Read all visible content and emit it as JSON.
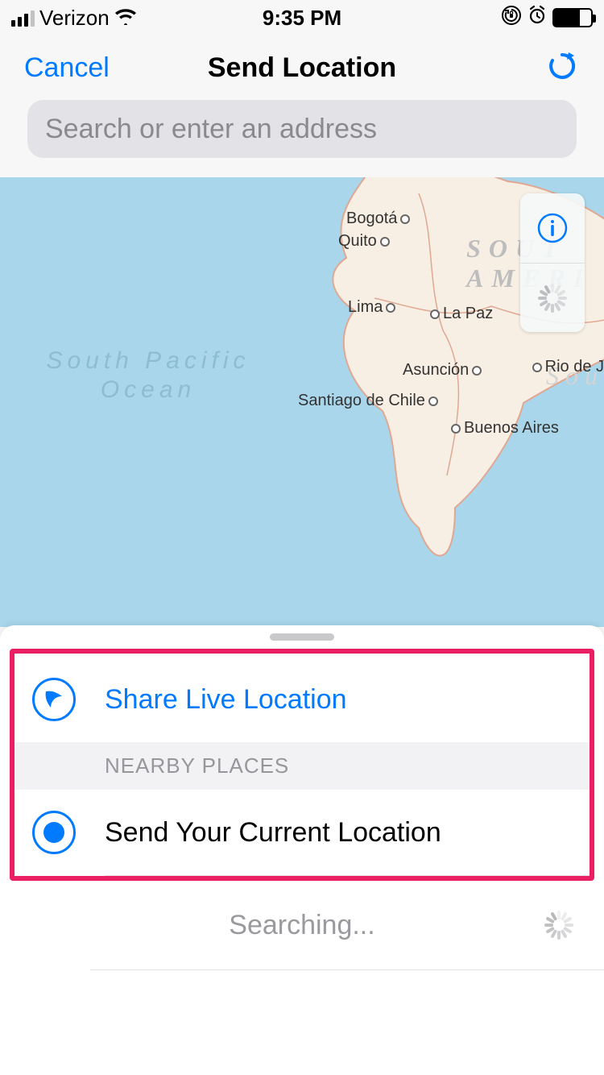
{
  "status": {
    "carrier": "Verizon",
    "time": "9:35 PM"
  },
  "nav": {
    "cancel": "Cancel",
    "title": "Send Location"
  },
  "search": {
    "placeholder": "Search or enter an address",
    "value": ""
  },
  "map": {
    "ocean_label": "South Pacific Ocean",
    "continent_label_1": "SOUT",
    "continent_label_2": "AMERI",
    "continent_label_3": "Sou",
    "rio_label": "Rio de J",
    "cities": {
      "bogota": "Bogotá",
      "quito": "Quito",
      "lima": "Lima",
      "lapaz": "La Paz",
      "asuncion": "Asunción",
      "santiago": "Santiago de Chile",
      "buenos": "Buenos Aires"
    }
  },
  "sheet": {
    "share_live": "Share Live Location",
    "nearby_header": "NEARBY PLACES",
    "send_current": "Send Your Current Location",
    "searching": "Searching..."
  },
  "colors": {
    "accent": "#007aff",
    "highlight": "#ea1e63"
  }
}
